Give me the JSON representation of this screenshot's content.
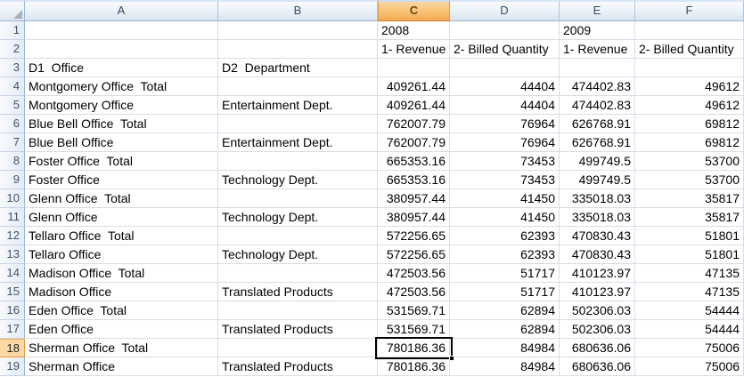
{
  "spreadsheet": {
    "columns": [
      "A",
      "B",
      "C",
      "D",
      "E",
      "F"
    ],
    "rows": [
      {
        "n": "1",
        "cells": [
          "",
          "",
          "2008",
          "",
          "2009",
          ""
        ]
      },
      {
        "n": "2",
        "cells": [
          "",
          "",
          "1- Revenue",
          "2- Billed Quantity",
          "1- Revenue",
          "2- Billed Quantity"
        ]
      },
      {
        "n": "3",
        "cells": [
          "D1  Office",
          "D2  Department",
          "",
          "",
          "",
          ""
        ]
      },
      {
        "n": "4",
        "cells": [
          "Montgomery Office  Total",
          "",
          "409261.44",
          "44404",
          "474402.83",
          "49612"
        ]
      },
      {
        "n": "5",
        "cells": [
          "Montgomery Office",
          "Entertainment Dept.",
          "409261.44",
          "44404",
          "474402.83",
          "49612"
        ]
      },
      {
        "n": "6",
        "cells": [
          "Blue Bell Office  Total",
          "",
          "762007.79",
          "76964",
          "626768.91",
          "69812"
        ]
      },
      {
        "n": "7",
        "cells": [
          "Blue Bell Office",
          "Entertainment Dept.",
          "762007.79",
          "76964",
          "626768.91",
          "69812"
        ]
      },
      {
        "n": "8",
        "cells": [
          "Foster Office  Total",
          "",
          "665353.16",
          "73453",
          "499749.5",
          "53700"
        ]
      },
      {
        "n": "9",
        "cells": [
          "Foster Office",
          "Technology Dept.",
          "665353.16",
          "73453",
          "499749.5",
          "53700"
        ]
      },
      {
        "n": "10",
        "cells": [
          "Glenn Office  Total",
          "",
          "380957.44",
          "41450",
          "335018.03",
          "35817"
        ]
      },
      {
        "n": "11",
        "cells": [
          "Glenn Office",
          "Technology Dept.",
          "380957.44",
          "41450",
          "335018.03",
          "35817"
        ]
      },
      {
        "n": "12",
        "cells": [
          "Tellaro Office  Total",
          "",
          "572256.65",
          "62393",
          "470830.43",
          "51801"
        ]
      },
      {
        "n": "13",
        "cells": [
          "Tellaro Office",
          "Technology Dept.",
          "572256.65",
          "62393",
          "470830.43",
          "51801"
        ]
      },
      {
        "n": "14",
        "cells": [
          "Madison Office  Total",
          "",
          "472503.56",
          "51717",
          "410123.97",
          "47135"
        ]
      },
      {
        "n": "15",
        "cells": [
          "Madison Office",
          "Translated Products",
          "472503.56",
          "51717",
          "410123.97",
          "47135"
        ]
      },
      {
        "n": "16",
        "cells": [
          "Eden Office  Total",
          "",
          "531569.71",
          "62894",
          "502306.03",
          "54444"
        ]
      },
      {
        "n": "17",
        "cells": [
          "Eden Office",
          "Translated Products",
          "531569.71",
          "62894",
          "502306.03",
          "54444"
        ]
      },
      {
        "n": "18",
        "cells": [
          "Sherman Office  Total",
          "",
          "780186.36",
          "84984",
          "680636.06",
          "75006"
        ]
      },
      {
        "n": "19",
        "cells": [
          "Sherman Office",
          "Translated Products",
          "780186.36",
          "84984",
          "680636.06",
          "75006"
        ]
      }
    ],
    "selection": {
      "cell": "C18",
      "column": "C",
      "row": "18",
      "value": "780186.36"
    },
    "colors": {
      "selected_header_orange_top": "#FBD7A0",
      "selected_header_orange_bottom": "#F4A851",
      "selected_row_header": "#FBD9A6",
      "header_gradient_top": "#F9FBFE",
      "header_gradient_bottom": "#D9E4F1",
      "header_border": "#9EB6CE",
      "gridline": "#D6DDE8",
      "selection_border": "#000000"
    }
  }
}
